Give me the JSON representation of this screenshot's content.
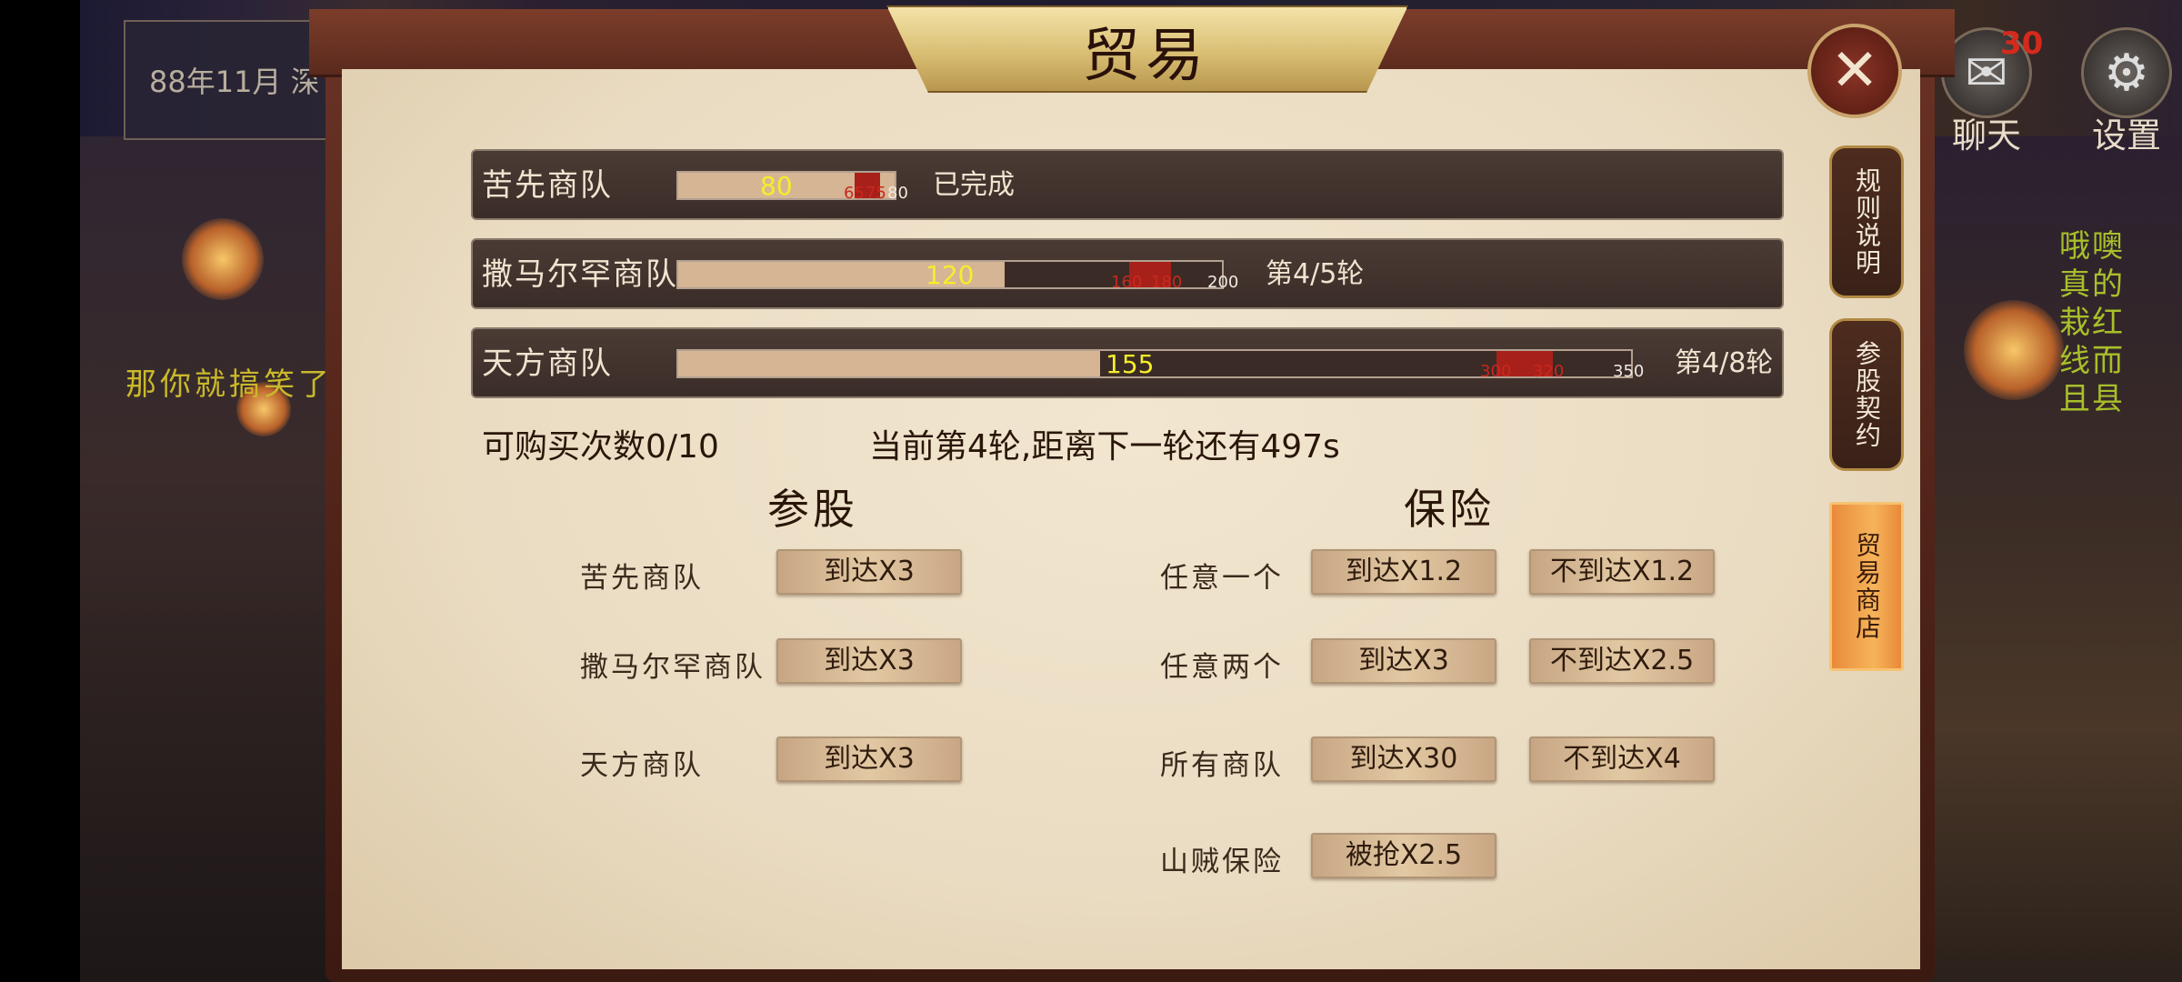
{
  "background": {
    "date_box": "88年11月  深",
    "left_scroll_text": "那你就搞笑了",
    "right_scroll_text": "哦噢真的栽红线而且县",
    "chat": {
      "label": "聊天",
      "count": "30"
    },
    "settings": {
      "label": "设置"
    }
  },
  "panel": {
    "title": "贸易"
  },
  "caravans": [
    {
      "name": "苦先商队",
      "progress": 80,
      "max": 80,
      "label": "80",
      "status": "已完成",
      "ticks": [
        {
          "text": "65",
          "color": "red"
        },
        {
          "text": "75",
          "color": "red"
        },
        {
          "text": "80",
          "color": "white"
        }
      ]
    },
    {
      "name": "撒马尔罕商队",
      "progress": 120,
      "max": 200,
      "label": "120",
      "status": "第4/5轮",
      "ticks": [
        {
          "text": "160",
          "color": "red"
        },
        {
          "text": "180",
          "color": "red"
        },
        {
          "text": "200",
          "color": "white"
        }
      ]
    },
    {
      "name": "天方商队",
      "progress": 155,
      "max": 350,
      "label": "155",
      "status": "第4/8轮",
      "ticks": [
        {
          "text": "300",
          "color": "red"
        },
        {
          "text": "320",
          "color": "red"
        },
        {
          "text": "350",
          "color": "white"
        }
      ]
    }
  ],
  "info": {
    "purchases": "可购买次数0/10",
    "round": "当前第4轮,距离下一轮还有497s"
  },
  "investment": {
    "title": "参股",
    "items": [
      {
        "label": "苦先商队",
        "button": "到达X3"
      },
      {
        "label": "撒马尔罕商队",
        "button": "到达X3"
      },
      {
        "label": "天方商队",
        "button": "到达X3"
      }
    ]
  },
  "insurance": {
    "title": "保险",
    "items": [
      {
        "label": "任意一个",
        "arrive": "到达X1.2",
        "not_arrive": "不到达X1.2"
      },
      {
        "label": "任意两个",
        "arrive": "到达X3",
        "not_arrive": "不到达X2.5"
      },
      {
        "label": "所有商队",
        "arrive": "到达X30",
        "not_arrive": "不到达X4"
      },
      {
        "label": "山贼保险",
        "arrive": "被抢X2.5"
      }
    ]
  },
  "side_tabs": [
    "规则说明",
    "参股契约",
    "贸易商店"
  ],
  "colors": {
    "fill": "#d6b595",
    "red_zone": "#a8201a",
    "active_tab": "#f0a04a",
    "value_text": "#f5ee2a"
  }
}
